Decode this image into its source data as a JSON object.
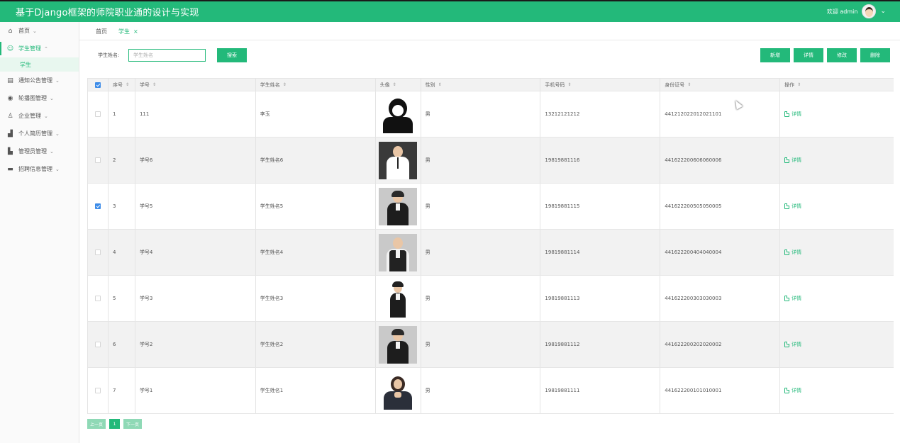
{
  "app": {
    "title": "基于Django框架的师院职业通的设计与实现",
    "welcome": "欢迎 admin",
    "accent_color": "#23b97a"
  },
  "sidebar": {
    "items": [
      {
        "label": "首页",
        "icon": "home-icon",
        "expanded": false
      },
      {
        "label": "学生管理",
        "icon": "student-icon",
        "expanded": true,
        "active": true
      },
      {
        "label": "通知公告管理",
        "icon": "notice-icon",
        "expanded": false
      },
      {
        "label": "轮播图管理",
        "icon": "carousel-icon",
        "expanded": false
      },
      {
        "label": "企业管理",
        "icon": "user-icon",
        "expanded": false
      },
      {
        "label": "个人简历管理",
        "icon": "resume-icon",
        "expanded": false
      },
      {
        "label": "管理员管理",
        "icon": "admin-icon",
        "expanded": false
      },
      {
        "label": "招聘信息管理",
        "icon": "job-icon",
        "expanded": false
      }
    ],
    "sub_item": "学生"
  },
  "tabs": {
    "home": "首页",
    "current": "学生"
  },
  "search": {
    "label": "学生姓名:",
    "placeholder": "学生姓名",
    "button": "搜索"
  },
  "actions": {
    "add": "新增",
    "detail": "详情",
    "edit": "修改",
    "delete": "删除"
  },
  "table": {
    "columns": [
      "序号",
      "学号",
      "学生姓名",
      "头像",
      "性别",
      "手机号码",
      "身份证号",
      "操作"
    ],
    "rows": [
      {
        "idx": "1",
        "no": "111",
        "name": "李玉",
        "sex": "男",
        "phone": "13212121212",
        "id_card": "441212022012021101",
        "op": "详情",
        "checked": false
      },
      {
        "idx": "2",
        "no": "学号6",
        "name": "学生姓名6",
        "sex": "男",
        "phone": "19819881116",
        "id_card": "441622200606060006",
        "op": "详情",
        "checked": false
      },
      {
        "idx": "3",
        "no": "学号5",
        "name": "学生姓名5",
        "sex": "男",
        "phone": "19819881115",
        "id_card": "441622200505050005",
        "op": "详情",
        "checked": true
      },
      {
        "idx": "4",
        "no": "学号4",
        "name": "学生姓名4",
        "sex": "男",
        "phone": "19819881114",
        "id_card": "441622200404040004",
        "op": "详情",
        "checked": false
      },
      {
        "idx": "5",
        "no": "学号3",
        "name": "学生姓名3",
        "sex": "男",
        "phone": "19819881113",
        "id_card": "441622200303030003",
        "op": "详情",
        "checked": false
      },
      {
        "idx": "6",
        "no": "学号2",
        "name": "学生姓名2",
        "sex": "男",
        "phone": "19819881112",
        "id_card": "441622200202020002",
        "op": "详情",
        "checked": false
      },
      {
        "idx": "7",
        "no": "学号1",
        "name": "学生姓名1",
        "sex": "男",
        "phone": "19819881111",
        "id_card": "441622200101010001",
        "op": "详情",
        "checked": false
      }
    ]
  },
  "pagination": {
    "prev": "上一页",
    "current": "1",
    "next": "下一页"
  }
}
